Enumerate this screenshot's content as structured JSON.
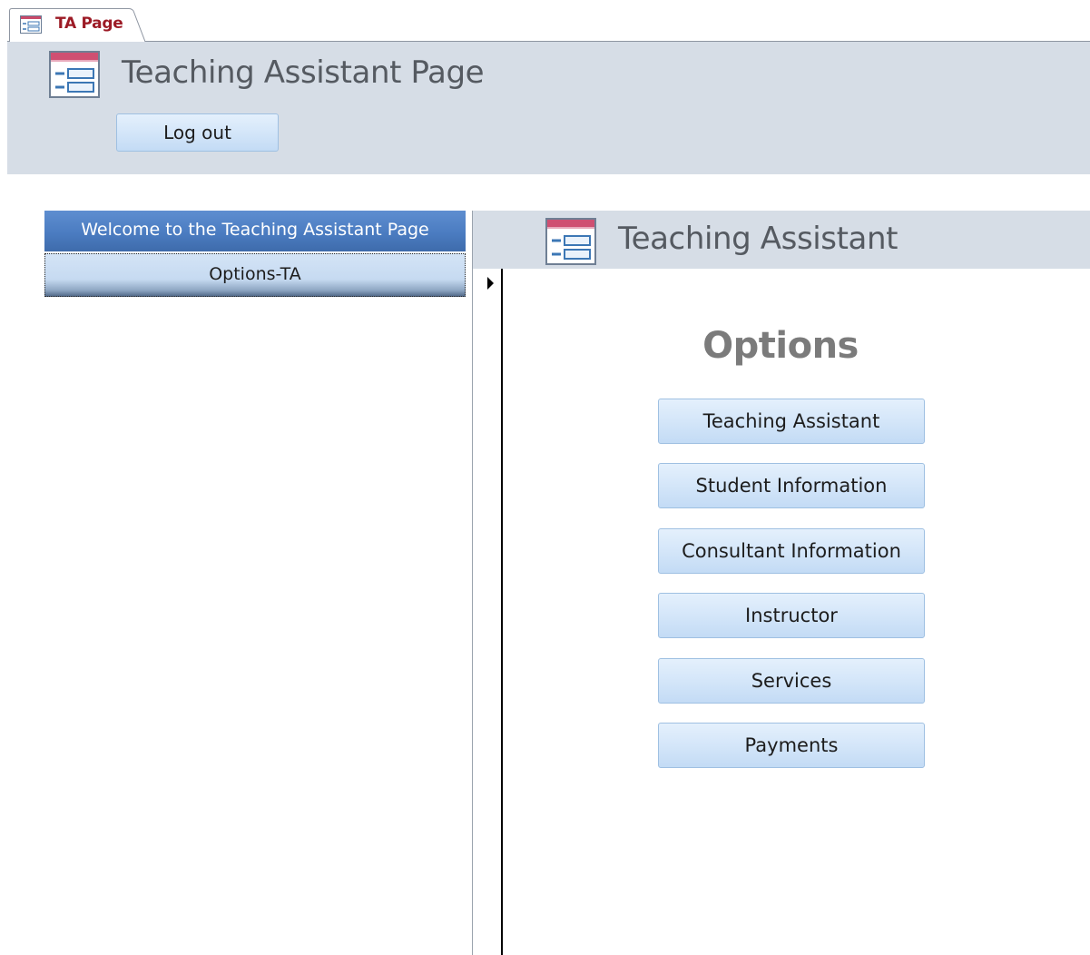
{
  "tab": {
    "label": "TA Page"
  },
  "header": {
    "title": "Teaching Assistant Page",
    "logout_label": "Log out"
  },
  "navigation": {
    "header": "Welcome to the Teaching Assistant Page",
    "items": [
      {
        "label": "Options-TA"
      }
    ]
  },
  "subform": {
    "title": "Teaching Assistant",
    "section_title": "Options",
    "buttons": [
      {
        "label": "Teaching Assistant"
      },
      {
        "label": "Student Information"
      },
      {
        "label": "Consultant Information"
      },
      {
        "label": "Instructor"
      },
      {
        "label": "Services"
      },
      {
        "label": "Payments"
      }
    ]
  },
  "colors": {
    "accent": "#4b7cc1",
    "tab_text": "#9c1a25",
    "header_bg": "#d6dde6"
  }
}
